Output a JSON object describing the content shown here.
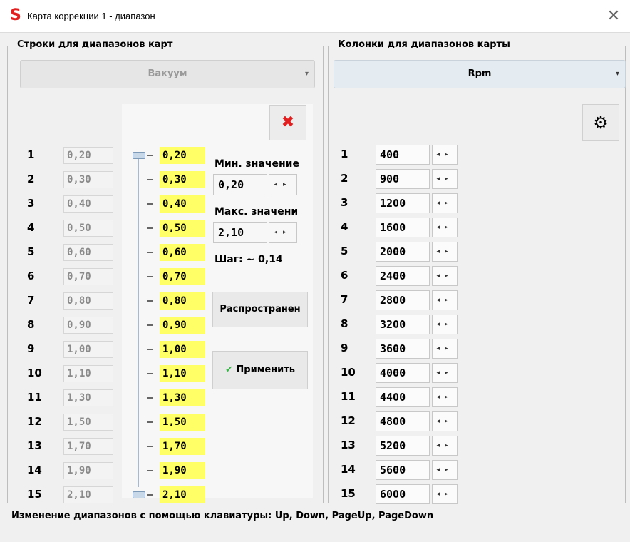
{
  "window": {
    "title": "Карта коррекции 1 - диапазон",
    "close_glyph": "✕"
  },
  "rows_group": {
    "legend": "Строки для диапазонов карт",
    "combo_value": "Вакуум",
    "delete_icon": "✖",
    "rows": [
      {
        "n": "1",
        "old": "0,20",
        "new": "0,20"
      },
      {
        "n": "2",
        "old": "0,30",
        "new": "0,30"
      },
      {
        "n": "3",
        "old": "0,40",
        "new": "0,40"
      },
      {
        "n": "4",
        "old": "0,50",
        "new": "0,50"
      },
      {
        "n": "5",
        "old": "0,60",
        "new": "0,60"
      },
      {
        "n": "6",
        "old": "0,70",
        "new": "0,70"
      },
      {
        "n": "7",
        "old": "0,80",
        "new": "0,80"
      },
      {
        "n": "8",
        "old": "0,90",
        "new": "0,90"
      },
      {
        "n": "9",
        "old": "1,00",
        "new": "1,00"
      },
      {
        "n": "10",
        "old": "1,10",
        "new": "1,10"
      },
      {
        "n": "11",
        "old": "1,30",
        "new": "1,30"
      },
      {
        "n": "12",
        "old": "1,50",
        "new": "1,50"
      },
      {
        "n": "13",
        "old": "1,70",
        "new": "1,70"
      },
      {
        "n": "14",
        "old": "1,90",
        "new": "1,90"
      },
      {
        "n": "15",
        "old": "2,10",
        "new": "2,10"
      }
    ],
    "min_label": "Мин. значение",
    "min_value": "0,20",
    "max_label": "Макс. значени",
    "max_value": "2,10",
    "step_label": "Шаг: ~ 0,14",
    "distribute_button": "Распространен",
    "apply_button": "Применить",
    "apply_check": "✔"
  },
  "cols_group": {
    "legend": "Колонки для диапазонов карты",
    "combo_value": "Rpm",
    "gear_icon": "⚙",
    "cols": [
      {
        "n": "1",
        "v": "400"
      },
      {
        "n": "2",
        "v": "900"
      },
      {
        "n": "3",
        "v": "1200"
      },
      {
        "n": "4",
        "v": "1600"
      },
      {
        "n": "5",
        "v": "2000"
      },
      {
        "n": "6",
        "v": "2400"
      },
      {
        "n": "7",
        "v": "2800"
      },
      {
        "n": "8",
        "v": "3200"
      },
      {
        "n": "9",
        "v": "3600"
      },
      {
        "n": "10",
        "v": "4000"
      },
      {
        "n": "11",
        "v": "4400"
      },
      {
        "n": "12",
        "v": "4800"
      },
      {
        "n": "13",
        "v": "5200"
      },
      {
        "n": "14",
        "v": "5600"
      },
      {
        "n": "15",
        "v": "6000"
      }
    ]
  },
  "spin_arrows": "◂▸",
  "combo_arrow": "▾",
  "status_text": "Изменение диапазонов с помощью клавиатуры: Up, Down, PageUp, PageDown"
}
